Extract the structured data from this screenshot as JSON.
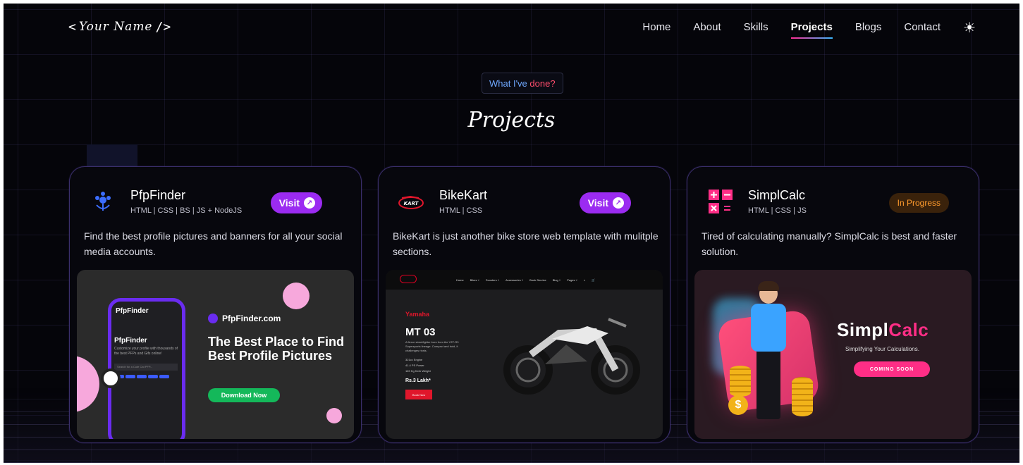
{
  "header": {
    "logo": {
      "open": "<",
      "script": "Your Name",
      "close": "/>"
    },
    "nav": [
      {
        "label": "Home"
      },
      {
        "label": "About"
      },
      {
        "label": "Skills"
      },
      {
        "label": "Projects",
        "active": true
      },
      {
        "label": "Blogs"
      },
      {
        "label": "Contact"
      }
    ],
    "theme_icon": "sun-icon",
    "theme_glyph": "☀"
  },
  "section": {
    "tagline_part1": "What I've",
    "tagline_part2": "done?",
    "title": "Projects"
  },
  "projects": [
    {
      "name": "PfpFinder",
      "stack": "HTML | CSS | BS | JS + NodeJS",
      "description": "Find the best profile pictures and banners for all your social media accounts.",
      "action": "Visit",
      "icon": "flower-icon",
      "preview": {
        "phone_header": "PfpFinder",
        "phone_title": "PfpFinder",
        "phone_sub": "Customize your profile with thousands of the best PFPs and Gifs online!",
        "phone_search": "Search for a Cute Cat PFP...",
        "brand": "PfpFinder.com",
        "headline": "The Best Place to Find Best Profile Pictures",
        "button": "Download Now"
      }
    },
    {
      "name": "BikeKart",
      "stack": "HTML | CSS",
      "description": "BikeKart is just another bike store web template with mulitple sections.",
      "action": "Visit",
      "icon": "bike-logo-icon",
      "preview": {
        "menu": [
          "Home",
          "Bikes ˅",
          "Scooters ˅",
          "Accessories ˅",
          "Book Service",
          "Blog ˅",
          "Pages ˅"
        ],
        "brand": "Yamaha",
        "model": "MT 03",
        "blurb": "A fierce streetfighter born from the YZF-R3 Supersports lineage. Compact and bold, it challenges rivals.",
        "specs": [
          "321cc Engine",
          "41.4 PS Power",
          "169 Kg Kerb Weight"
        ],
        "price": "Rs.3 Lakh*",
        "button": "Book Now"
      }
    },
    {
      "name": "SimplCalc",
      "stack": "HTML | CSS | JS",
      "description": "Tired of calculating manually? SimplCalc is best and faster solution.",
      "status": "In Progress",
      "icon": "calculator-icon",
      "preview": {
        "title_a": "Simpl",
        "title_b": "Calc",
        "subtitle": "Simplifying Your Calculations.",
        "button": "COMING SOON"
      }
    }
  ],
  "colors": {
    "accent_purple": "#9b2bf1",
    "accent_pink": "#ff2e86",
    "progress_orange": "#ff9b2d",
    "nav_underline_start": "#ff2d95",
    "nav_underline_end": "#3ab8ff"
  }
}
